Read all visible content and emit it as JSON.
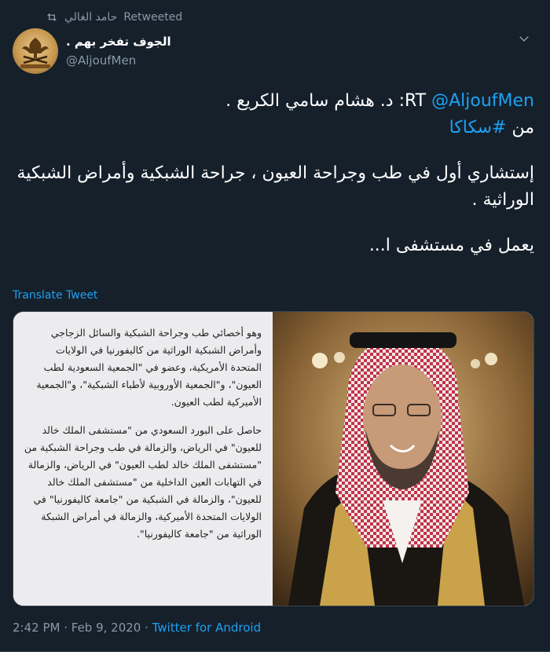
{
  "retweet": {
    "retweeter": "حامد الغالي",
    "label": "Retweeted"
  },
  "author": {
    "name": "الجوف تفخر بهم .",
    "handle": "@AljoufMen"
  },
  "tweet": {
    "rt_prefix": "RT",
    "mention": "@AljoufMen",
    "line1_rest": ": د. هشام سامي الكريع .",
    "from_word": "من",
    "hashtag": "#سكاكا",
    "paragraph2": "إستشاري أول في طب وجراحة العيون ، جراحة الشبكية وأمراض الشبكية الوراثية .",
    "paragraph3": "يعمل في مستشفى ا..."
  },
  "translate_label": "Translate Tweet",
  "media": {
    "text_block1": "وهو أخصائي طب وجراحة الشبكية والسائل الزجاجي وأمراض الشبكية الوراثية من كاليفورنيا في الولايات المتحدة الأمريكية، وعضو في \"الجمعية السعودية لطب العيون\"، و\"الجمعية الأوروبية لأطباء الشبكية\"، و\"الجمعية الأميركية لطب العيون.",
    "text_block2": "حاصل على البورد السعودي من \"مستشفى الملك خالد للعيون\" في الرياض، والزمالة في طب وجراحة الشبكية من \"مستشفى الملك خالد لطب العيون\" في الرياض، والزمالة في التهابات العين الداخلية من \"مستشفى الملك خالد للعيون\"، والزمالة في الشبكية من \"جامعة كاليفورنيا\" في الولايات المتحدة الأميركية، والزمالة في أمراض الشبكة الوراثية من \"جامعة كاليفورنيا\"."
  },
  "meta": {
    "time": "2:42 PM",
    "separator": " · ",
    "date": "Feb 9, 2020",
    "separator2": " · ",
    "source": "Twitter for Android"
  },
  "icons": {
    "retweet": "retweet-icon",
    "more": "chevron-down-icon",
    "avatar": "avatar-logo"
  },
  "colors": {
    "background": "#15202b",
    "accent": "#1da1f2",
    "muted": "#8899a6"
  }
}
